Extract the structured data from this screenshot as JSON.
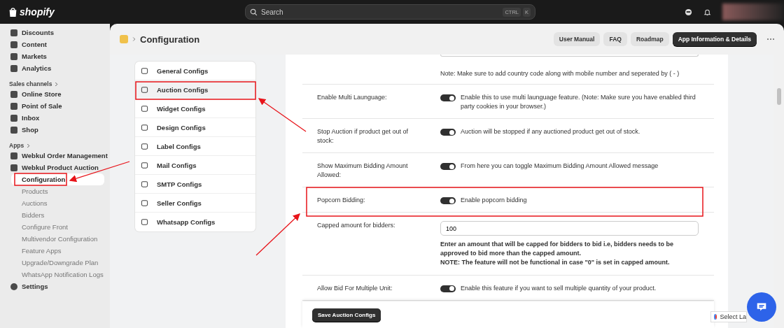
{
  "topbar": {
    "brand": "shopify",
    "search": {
      "placeholder": "Search",
      "shortcut": [
        "CTRL",
        "K"
      ]
    }
  },
  "sidebar": {
    "groups": [
      {
        "items": [
          {
            "label": "Discounts"
          },
          {
            "label": "Content"
          },
          {
            "label": "Markets"
          },
          {
            "label": "Analytics"
          }
        ]
      },
      {
        "heading": "Sales channels",
        "items": [
          {
            "label": "Online Store"
          },
          {
            "label": "Point of Sale"
          },
          {
            "label": "Inbox"
          },
          {
            "label": "Shop"
          }
        ]
      },
      {
        "heading": "Apps",
        "items": [
          {
            "label": "Webkul Order Management"
          },
          {
            "label": "Webkul Product Auction",
            "children": [
              {
                "label": "Configuration",
                "selected": true
              },
              {
                "label": "Products",
                "selected": false
              },
              {
                "label": "Auctions",
                "selected": false
              },
              {
                "label": "Bidders",
                "selected": false
              },
              {
                "label": "Configure Front",
                "selected": false
              },
              {
                "label": "Multivendor Configuration",
                "selected": false
              },
              {
                "label": "Feature Apps",
                "selected": false
              },
              {
                "label": "Upgrade/Downgrade Plan",
                "selected": false
              },
              {
                "label": "WhatsApp Notification Logs",
                "selected": false
              }
            ]
          }
        ]
      }
    ],
    "settings": "Settings"
  },
  "header": {
    "title": "Configuration",
    "buttons": [
      {
        "label": "User Manual",
        "kind": "secondary"
      },
      {
        "label": "FAQ",
        "kind": "secondary"
      },
      {
        "label": "Roadmap",
        "kind": "secondary"
      },
      {
        "label": "App Information & Details",
        "kind": "primary"
      }
    ]
  },
  "config_nav": [
    {
      "label": "General Configs",
      "selected": false
    },
    {
      "label": "Auction Configs",
      "selected": true
    },
    {
      "label": "Widget Configs",
      "selected": false
    },
    {
      "label": "Design Configs",
      "selected": false
    },
    {
      "label": "Label Configs",
      "selected": false
    },
    {
      "label": "Mail Configs",
      "selected": false
    },
    {
      "label": "SMTP Configs",
      "selected": false
    },
    {
      "label": "Seller Configs",
      "selected": false
    },
    {
      "label": "Whatsapp Configs",
      "selected": false
    }
  ],
  "settings_rows": [
    {
      "kind": "note",
      "note": "Note:  Make sure to add country code along with mobile number and seperated by ( - )"
    },
    {
      "kind": "toggle",
      "label": "Enable Multi Launguage:",
      "on": true,
      "description": "Enable this to use multi launguage feature. (Note: Make sure you have enabled third party cookies in your browser.)"
    },
    {
      "kind": "toggle",
      "label": "Stop Auction if product get out of stock:",
      "on": true,
      "description": "Auction will be stopped if any auctioned product get out of stock."
    },
    {
      "kind": "toggle",
      "label": "Show Maximum Bidding Amount Allowed:",
      "on": true,
      "description": "From here you can toggle Maximum Bidding Amount Allowed message"
    },
    {
      "kind": "toggle",
      "label": "Popcorn Bidding:",
      "on": true,
      "description": "Enable popcorn bidding"
    },
    {
      "kind": "input",
      "label": "Capped amount for bidders:",
      "value": "100",
      "help": [
        "Enter an amount that will be capped for bidders to bid i.e, bidders needs to be approved to bid more than the capped amount.",
        "NOTE: The feature will not be functional in case \"0\" is set in capped amount."
      ]
    },
    {
      "kind": "toggle",
      "label": "Allow Bid For Multiple Unit:",
      "on": true,
      "description": "Enable this feature if you want to sell multiple quantity of your product."
    }
  ],
  "save_button": "Save Auction Configs",
  "translate_widget": "Select La"
}
